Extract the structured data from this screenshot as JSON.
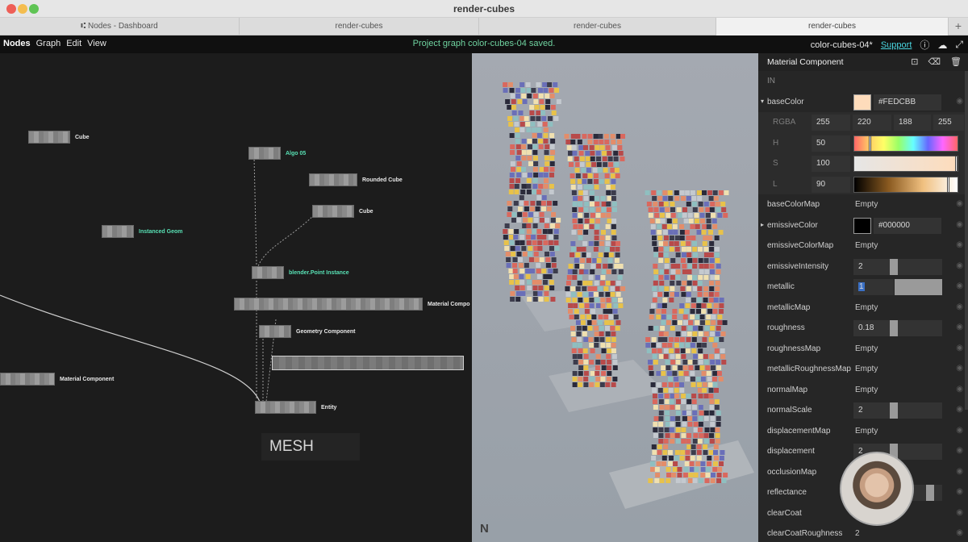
{
  "window": {
    "title": "render-cubes"
  },
  "tabs": [
    {
      "label": "⑆ Nodes - Dashboard",
      "active": false
    },
    {
      "label": "render-cubes",
      "active": false
    },
    {
      "label": "render-cubes",
      "active": false
    },
    {
      "label": "render-cubes",
      "active": true
    }
  ],
  "tab_add": "+",
  "appbar": {
    "menu": [
      "Nodes",
      "Graph",
      "Edit",
      "View"
    ],
    "status": "Project graph color-cubes-04 saved.",
    "project": "color-cubes-04*",
    "support": "Support"
  },
  "graph": {
    "nodes": [
      {
        "label": "Cube",
        "accent": false
      },
      {
        "label": "Algo 05",
        "accent": true
      },
      {
        "label": "Rounded Cube",
        "accent": false
      },
      {
        "label": "Cube",
        "accent": false
      },
      {
        "label": "Instanced Geom",
        "accent": true
      },
      {
        "label": "blender.Point Instance",
        "accent": true
      },
      {
        "label": "Material Compo",
        "accent": false
      },
      {
        "label": "Geometry Component",
        "accent": false
      },
      {
        "label": "Material Component",
        "accent": false
      },
      {
        "label": "Entity",
        "accent": false
      }
    ],
    "mesh_label": "MESH"
  },
  "viewport": {
    "logo": "N"
  },
  "panel": {
    "title": "Material Component",
    "in_label": "IN",
    "baseColor": {
      "key": "baseColor",
      "hex": "#FEDCBB",
      "swatch": "#FEDCBB"
    },
    "rgba": {
      "key": "RGBA",
      "values": [
        "255",
        "220",
        "188",
        "255"
      ]
    },
    "h": {
      "key": "H",
      "value": "50"
    },
    "s": {
      "key": "S",
      "value": "100"
    },
    "l": {
      "key": "L",
      "value": "90"
    },
    "emissiveColor": {
      "key": "emissiveColor",
      "hex": "#000000",
      "swatch": "#000000"
    },
    "metallic": {
      "key": "metallic",
      "value": "1"
    },
    "rows_before_emissive": [
      {
        "key": "baseColorMap",
        "value": "Empty"
      }
    ],
    "rows_after_emissive": [
      {
        "key": "emissiveColorMap",
        "value": "Empty"
      },
      {
        "key": "emissiveIntensity",
        "value": "2",
        "slider": 0.45
      }
    ],
    "rows_after_metallic": [
      {
        "key": "metallicMap",
        "value": "Empty"
      },
      {
        "key": "roughness",
        "value": "0.18",
        "slider": 0.45
      },
      {
        "key": "roughnessMap",
        "value": "Empty"
      },
      {
        "key": "metallicRoughnessMap",
        "value": "Empty"
      },
      {
        "key": "normalMap",
        "value": "Empty"
      },
      {
        "key": "normalScale",
        "value": "2",
        "slider": 0.45
      },
      {
        "key": "displacementMap",
        "value": "Empty"
      },
      {
        "key": "displacement",
        "value": "2",
        "slider": 0.45
      },
      {
        "key": "occlusionMap",
        "value": ""
      },
      {
        "key": "reflectance",
        "value": "",
        "slider": 0.9
      },
      {
        "key": "clearCoat",
        "value": ""
      },
      {
        "key": "clearCoatRoughness",
        "value": "2"
      }
    ]
  }
}
